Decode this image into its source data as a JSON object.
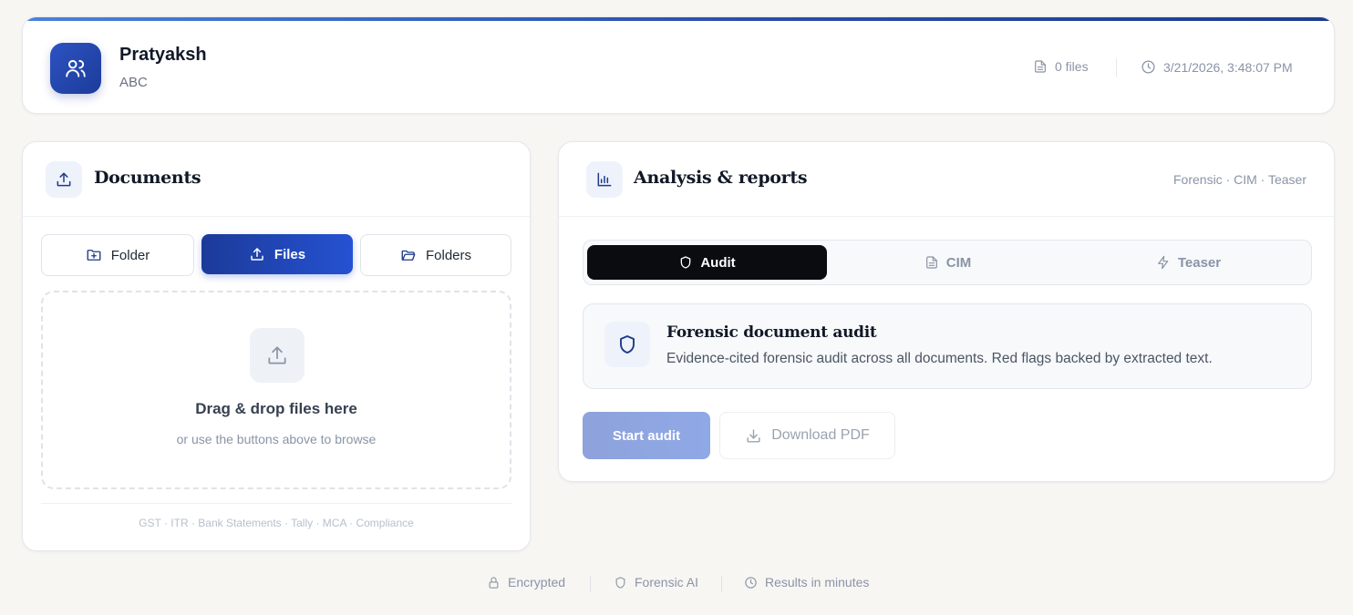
{
  "header": {
    "user_name": "Pratyaksh",
    "company": "ABC",
    "files_count": "0 files",
    "timestamp": "3/21/2026, 3:48:07 PM",
    "stripe_colors": [
      "#4a82d8",
      "#1c3d8f"
    ]
  },
  "documents": {
    "title": "Documents",
    "buttons": {
      "folder": "Folder",
      "files": "Files",
      "folders": "Folders"
    },
    "dropzone": {
      "title": "Drag & drop files here",
      "subtitle": "or use the buttons above to browse"
    },
    "supported_types": "GST · ITR · Bank Statements · Tally · MCA · Compliance"
  },
  "analysis": {
    "title": "Analysis & reports",
    "tags": "Forensic · CIM · Teaser",
    "tabs": [
      {
        "label": "Audit",
        "icon": "shield-icon",
        "active": true
      },
      {
        "label": "CIM",
        "icon": "document-icon",
        "active": false
      },
      {
        "label": "Teaser",
        "icon": "lightning-icon",
        "active": false
      }
    ],
    "panel": {
      "title": "Forensic document audit",
      "description": "Evidence-cited forensic audit across all documents. Red flags backed by extracted text."
    },
    "start_button": "Start audit",
    "download_button": "Download PDF"
  },
  "footer": {
    "encrypted": "Encrypted",
    "forensic_ai": "Forensic AI",
    "results": "Results in minutes"
  },
  "colors": {
    "primary": "#1f48c4",
    "active_tab": "#0b0c0f",
    "background": "#f7f6f3"
  }
}
